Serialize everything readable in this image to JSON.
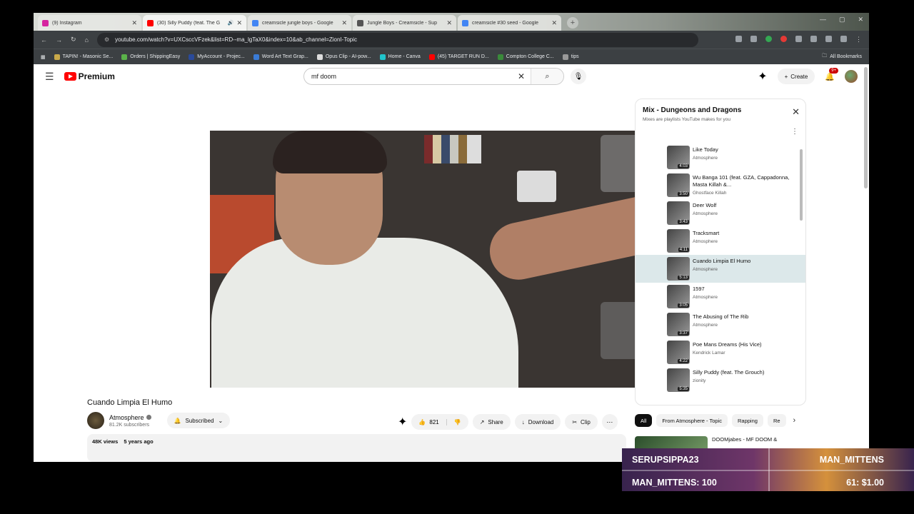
{
  "browser": {
    "tabs": [
      {
        "title": "(9) Instagram",
        "color": "#d6249f",
        "active": false
      },
      {
        "title": "(30) Silly Puddy (feat. The G",
        "color": "#ff0000",
        "active": true
      },
      {
        "title": "creamsicle jungle boys - Google",
        "color": "#4285f4",
        "active": false
      },
      {
        "title": "Jungle Boys - Creamsicle - Sup",
        "color": "#555555",
        "active": false
      },
      {
        "title": "creamsicle #30 seed - Google",
        "color": "#4285f4",
        "active": false
      }
    ],
    "url": "youtube.com/watch?v=UXCsccVFzek&list=RD--ma_lgTaX0&index=10&ab_channel=ZionI-Topic",
    "bookmarks": [
      {
        "label": "TAPIN! - Masonic Se...",
        "color": "#c9a94a"
      },
      {
        "label": "Orders | ShippingEasy",
        "color": "#5bb34a"
      },
      {
        "label": "MyAccount - Projec...",
        "color": "#2a4a9a"
      },
      {
        "label": "Word Art Text Grap...",
        "color": "#3a7bd5"
      },
      {
        "label": "Opus Clip - AI-pow...",
        "color": "#dddddd"
      },
      {
        "label": "Home - Canva",
        "color": "#20c4cb"
      },
      {
        "label": "(45) TARGET RUN D...",
        "color": "#ff0000"
      },
      {
        "label": "Compton College C...",
        "color": "#3a8a3a"
      },
      {
        "label": "tips",
        "color": "#999999"
      }
    ],
    "all_bookmarks": "All Bookmarks"
  },
  "youtube": {
    "logo_text": "Premium",
    "search_value": "mf doom",
    "create_label": "Create",
    "notif_badge": "9+",
    "video_title": "Cuando Limpia El Humo",
    "channel_name": "Atmosphere",
    "channel_subs": "81.2K subscribers",
    "subscribe_label": "Subscribed",
    "like_count": "821",
    "share_label": "Share",
    "download_label": "Download",
    "clip_label": "Clip",
    "views": "48K views",
    "age": "5 years ago"
  },
  "playlist": {
    "title": "Mix - Dungeons and Dragons",
    "subtitle": "Mixes are playlists YouTube makes for you",
    "items": [
      {
        "name": "Like Today",
        "artist": "Atmosphere",
        "duration": "4:03"
      },
      {
        "name": "Wu Banga 101 (feat. GZA, Cappadonna, Masta Killah &...",
        "artist": "Ghostface Killah",
        "duration": "3:50"
      },
      {
        "name": "Deer Wolf",
        "artist": "Atmosphere",
        "duration": "3:43"
      },
      {
        "name": "Tracksmart",
        "artist": "Atmosphere",
        "duration": "4:11"
      },
      {
        "name": "Cuando Limpia El Humo",
        "artist": "Atmosphere",
        "duration": "5:13",
        "current": true
      },
      {
        "name": "1597",
        "artist": "Atmosphere",
        "duration": "3:05"
      },
      {
        "name": "The Abusing of The Rib",
        "artist": "Atmosphere",
        "duration": "3:37"
      },
      {
        "name": "Poe Mans Dreams (His Vice)",
        "artist": "Kendrick Lamar",
        "duration": "4:22"
      },
      {
        "name": "Silly Puddy (feat. The Grouch)",
        "artist": "zionity",
        "duration": "5:35"
      }
    ]
  },
  "chips": [
    "All",
    "From Atmosphere - Topic",
    "Rapping",
    "Re"
  ],
  "rec": {
    "title": "DOOMjabes - MF DOOM &"
  },
  "ticker": {
    "row1_left": "SERUPSIPPA23",
    "row1_right": "MAN_MITTENS",
    "row2_left": "MAN_MITTENS: 100",
    "row2_right": "61: $1.00"
  }
}
